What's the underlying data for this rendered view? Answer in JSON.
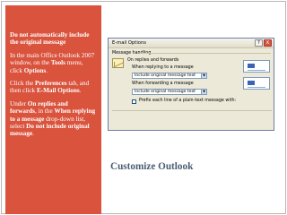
{
  "colors": {
    "panel_background": "#d9533d",
    "title_text": "#4b5d73",
    "dialog_background": "#ece9d8"
  },
  "notes": {
    "heading": "Do not automatically include the original message",
    "step1": {
      "prefix": "In the main Office Outlook 2007 window, on the ",
      "menu": "Tools",
      "middle": " menu, click ",
      "command": "Options",
      "suffix": "."
    },
    "step2": {
      "prefix": "Click the ",
      "tab": "Preferences",
      "middle": " tab, and then click ",
      "button": "E-Mail Options",
      "suffix": "."
    },
    "step3": {
      "prefix": "Under ",
      "section": "On replies and forwards",
      "middle": ", in the ",
      "list": "When replying to a message",
      "middle2": " drop-down list, select ",
      "option": "Do not include original message",
      "suffix": "."
    }
  },
  "slide_title": "Customize Outlook",
  "dialog": {
    "title": "E-mail Options",
    "help_glyph": "?",
    "close_glyph": "X",
    "group_label": "Message handling",
    "section_label": "On replies and forwards",
    "reply_label": "When replying to a message",
    "reply_value": "Include original message text",
    "forward_label": "When forwarding a message",
    "forward_value": "Include original message text",
    "prefix_label": "Prefix each line of a plain-text message with:",
    "dropdown_glyph": "▼",
    "mail_icon": "envelope-icon"
  }
}
